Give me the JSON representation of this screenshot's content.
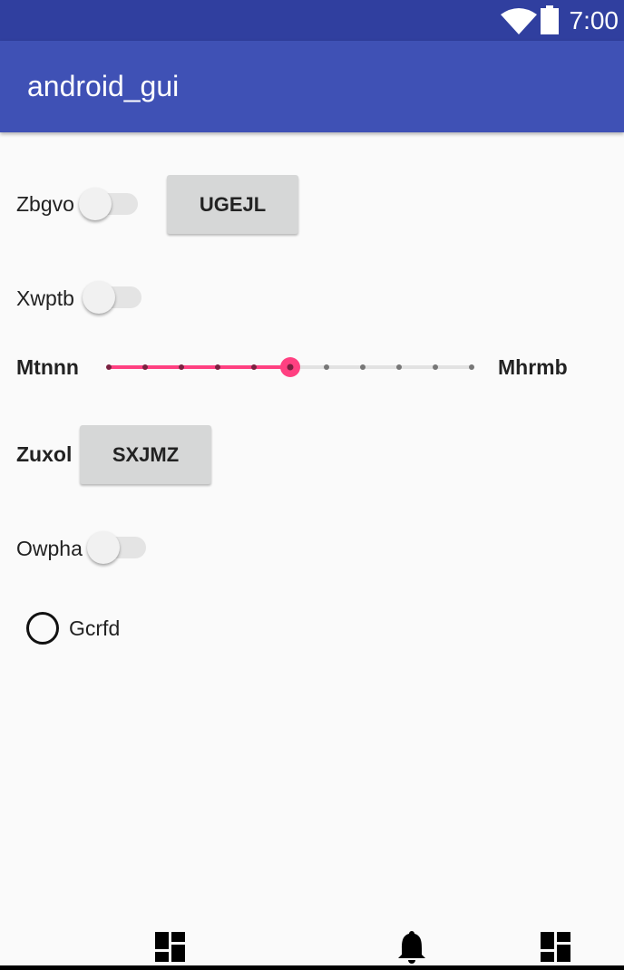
{
  "status_bar": {
    "time": "7:00",
    "icons": [
      "wifi-icon",
      "battery-icon"
    ]
  },
  "app_bar": {
    "title": "android_gui"
  },
  "widgets": {
    "switch1": {
      "label": "Zbgvo",
      "checked": false
    },
    "button1": {
      "label": "UGEJL"
    },
    "switch2": {
      "label": "Xwptb",
      "checked": false
    },
    "slider": {
      "left_label": "Mtnnn",
      "right_label": "Mhrmb",
      "min": 0,
      "max": 10,
      "value": 5,
      "accent": "#ff4081"
    },
    "label_zuxol": {
      "label": "Zuxol"
    },
    "button2": {
      "label": "SXJMZ"
    },
    "switch3": {
      "label": "Owpha",
      "checked": false
    },
    "radio": {
      "label": "Gcrfd",
      "checked": false
    }
  },
  "bottom_nav": {
    "icons": [
      "dashboard-icon",
      "bell-icon",
      "dashboard-icon"
    ]
  }
}
